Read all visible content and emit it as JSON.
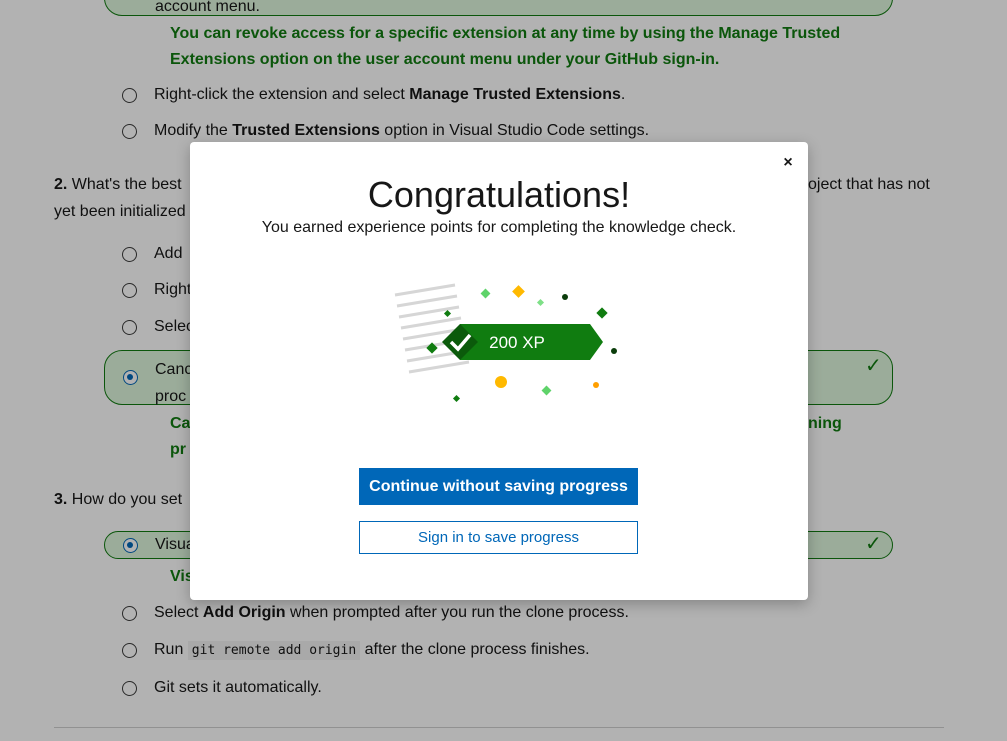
{
  "background": {
    "banner_tail_text": "account menu.",
    "q1": {
      "explanation_line1": "You can revoke access for a specific extension at any time by using the Manage Trusted",
      "explanation_line2": "Extensions option on the user account menu under your GitHub sign-in.",
      "option_rightclick_prefix": "Right-click the extension and select ",
      "option_rightclick_bold": "Manage Trusted Extensions",
      "option_rightclick_suffix": ".",
      "option_modify_prefix": "Modify the ",
      "option_modify_bold": "Trusted Extensions",
      "option_modify_suffix": " option in Visual Studio Code settings."
    },
    "q2": {
      "number": "2.",
      "text_left": "What's the best",
      "text_right": "oject that has not",
      "text_line2": "yet been initialized",
      "option_a": "Add",
      "option_b": "Right",
      "option_c": "Selec",
      "option_d_line1": "Canc",
      "option_d_line2": "proc",
      "explanation_left_line1": "Ca",
      "explanation_left_line2": "pr",
      "explanation_right": "ning"
    },
    "q3": {
      "number": "3.",
      "text_left": "How do you set",
      "option_a": "Visua",
      "explanation_left": "Vis",
      "option_b_prefix": "Select ",
      "option_b_bold": "Add Origin",
      "option_b_suffix": " when prompted after you run the clone process.",
      "option_c_prefix": "Run ",
      "option_c_code": "git remote add origin",
      "option_c_suffix": " after the clone process finishes.",
      "option_d": "Git sets it automatically."
    }
  },
  "modal": {
    "close_symbol": "×",
    "title": "Congratulations!",
    "subtitle": "You earned experience points for completing the knowledge check.",
    "xp_label": "200 XP",
    "primary_button": "Continue without saving progress",
    "secondary_button": "Sign in to save progress"
  },
  "colors": {
    "accent_blue": "#0067b8",
    "correct_green": "#107c10",
    "correct_bg": "#dff6dd",
    "xp_green": "#107c10",
    "confetti_gold": "#ffb900"
  },
  "icons": {
    "close": "close-icon",
    "check": "checkmark-icon",
    "radio": "radio-icon"
  }
}
